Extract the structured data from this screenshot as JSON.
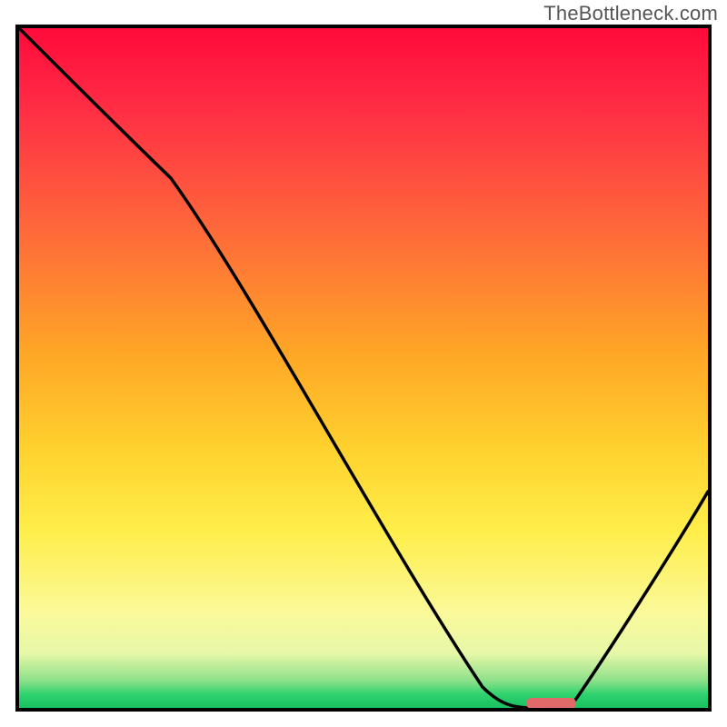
{
  "watermark": "TheBottleneck.com",
  "chart_data": {
    "type": "line",
    "title": "",
    "xlabel": "",
    "ylabel": "",
    "xlim": [
      0,
      100
    ],
    "ylim": [
      0,
      100
    ],
    "grid": false,
    "legend": false,
    "series": [
      {
        "name": "bottleneck-curve",
        "x": [
          0,
          22,
          70,
          74,
          80,
          100
        ],
        "y": [
          100,
          78,
          1,
          0,
          0,
          32
        ]
      }
    ],
    "marker": {
      "x_start": 74,
      "x_end": 80,
      "y": 0.5,
      "color": "#e06a6a"
    },
    "gradient_stops": [
      {
        "pos": 0,
        "color": "#ff0a3a"
      },
      {
        "pos": 12,
        "color": "#ff2e45"
      },
      {
        "pos": 30,
        "color": "#ff6a3a"
      },
      {
        "pos": 48,
        "color": "#ffa726"
      },
      {
        "pos": 62,
        "color": "#ffd22e"
      },
      {
        "pos": 74,
        "color": "#ffee4a"
      },
      {
        "pos": 86,
        "color": "#fbf99a"
      },
      {
        "pos": 92,
        "color": "#e6f8a8"
      },
      {
        "pos": 96,
        "color": "#8de08a"
      },
      {
        "pos": 98,
        "color": "#2fd36f"
      },
      {
        "pos": 100,
        "color": "#18c060"
      }
    ]
  }
}
